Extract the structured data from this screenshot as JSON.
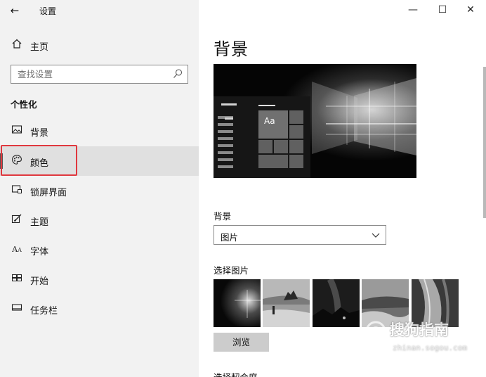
{
  "window": {
    "title": "设置",
    "back_icon": "back-arrow-icon",
    "minimize_symbol": "—",
    "maximize_symbol": "☐",
    "close_symbol": "✕"
  },
  "sidebar": {
    "home_label": "主页",
    "search_placeholder": "查找设置",
    "section_title": "个性化",
    "items": [
      {
        "label": "背景",
        "icon": "picture-icon"
      },
      {
        "label": "颜色",
        "icon": "palette-icon",
        "selected": true
      },
      {
        "label": "锁屏界面",
        "icon": "lock-screen-icon"
      },
      {
        "label": "主题",
        "icon": "theme-brush-icon"
      },
      {
        "label": "字体",
        "icon": "font-icon"
      },
      {
        "label": "开始",
        "icon": "start-icon"
      },
      {
        "label": "任务栏",
        "icon": "taskbar-icon"
      }
    ],
    "highlight_color": "#e0383e"
  },
  "main": {
    "page_title": "背景",
    "preview_tile_text": "Aa",
    "background_label": "背景",
    "background_value": "图片",
    "choose_picture_label": "选择图片",
    "browse_label": "浏览",
    "fit_label": "选择契合度"
  },
  "watermark": {
    "text": "搜狗指南",
    "url": "zhinan.sogou.com"
  }
}
